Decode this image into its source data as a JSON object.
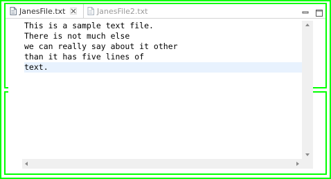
{
  "tabs": [
    {
      "label": "JanesFile.txt",
      "active": true,
      "icon": "text-file-icon"
    },
    {
      "label": "JanesFile2.txt",
      "active": false,
      "icon": "text-file-icon"
    }
  ],
  "editor": {
    "lines": [
      "This is a sample text file.",
      "There is not much else",
      "we can really say about it other",
      "than it has five lines of",
      "text."
    ],
    "current_line": 5
  },
  "window_controls": {
    "minimize_icon": "minimize-icon",
    "maximize_icon": "maximize-icon"
  },
  "colors": {
    "highlight_border": "#00ff00",
    "current_line": "#e8f2fe"
  }
}
